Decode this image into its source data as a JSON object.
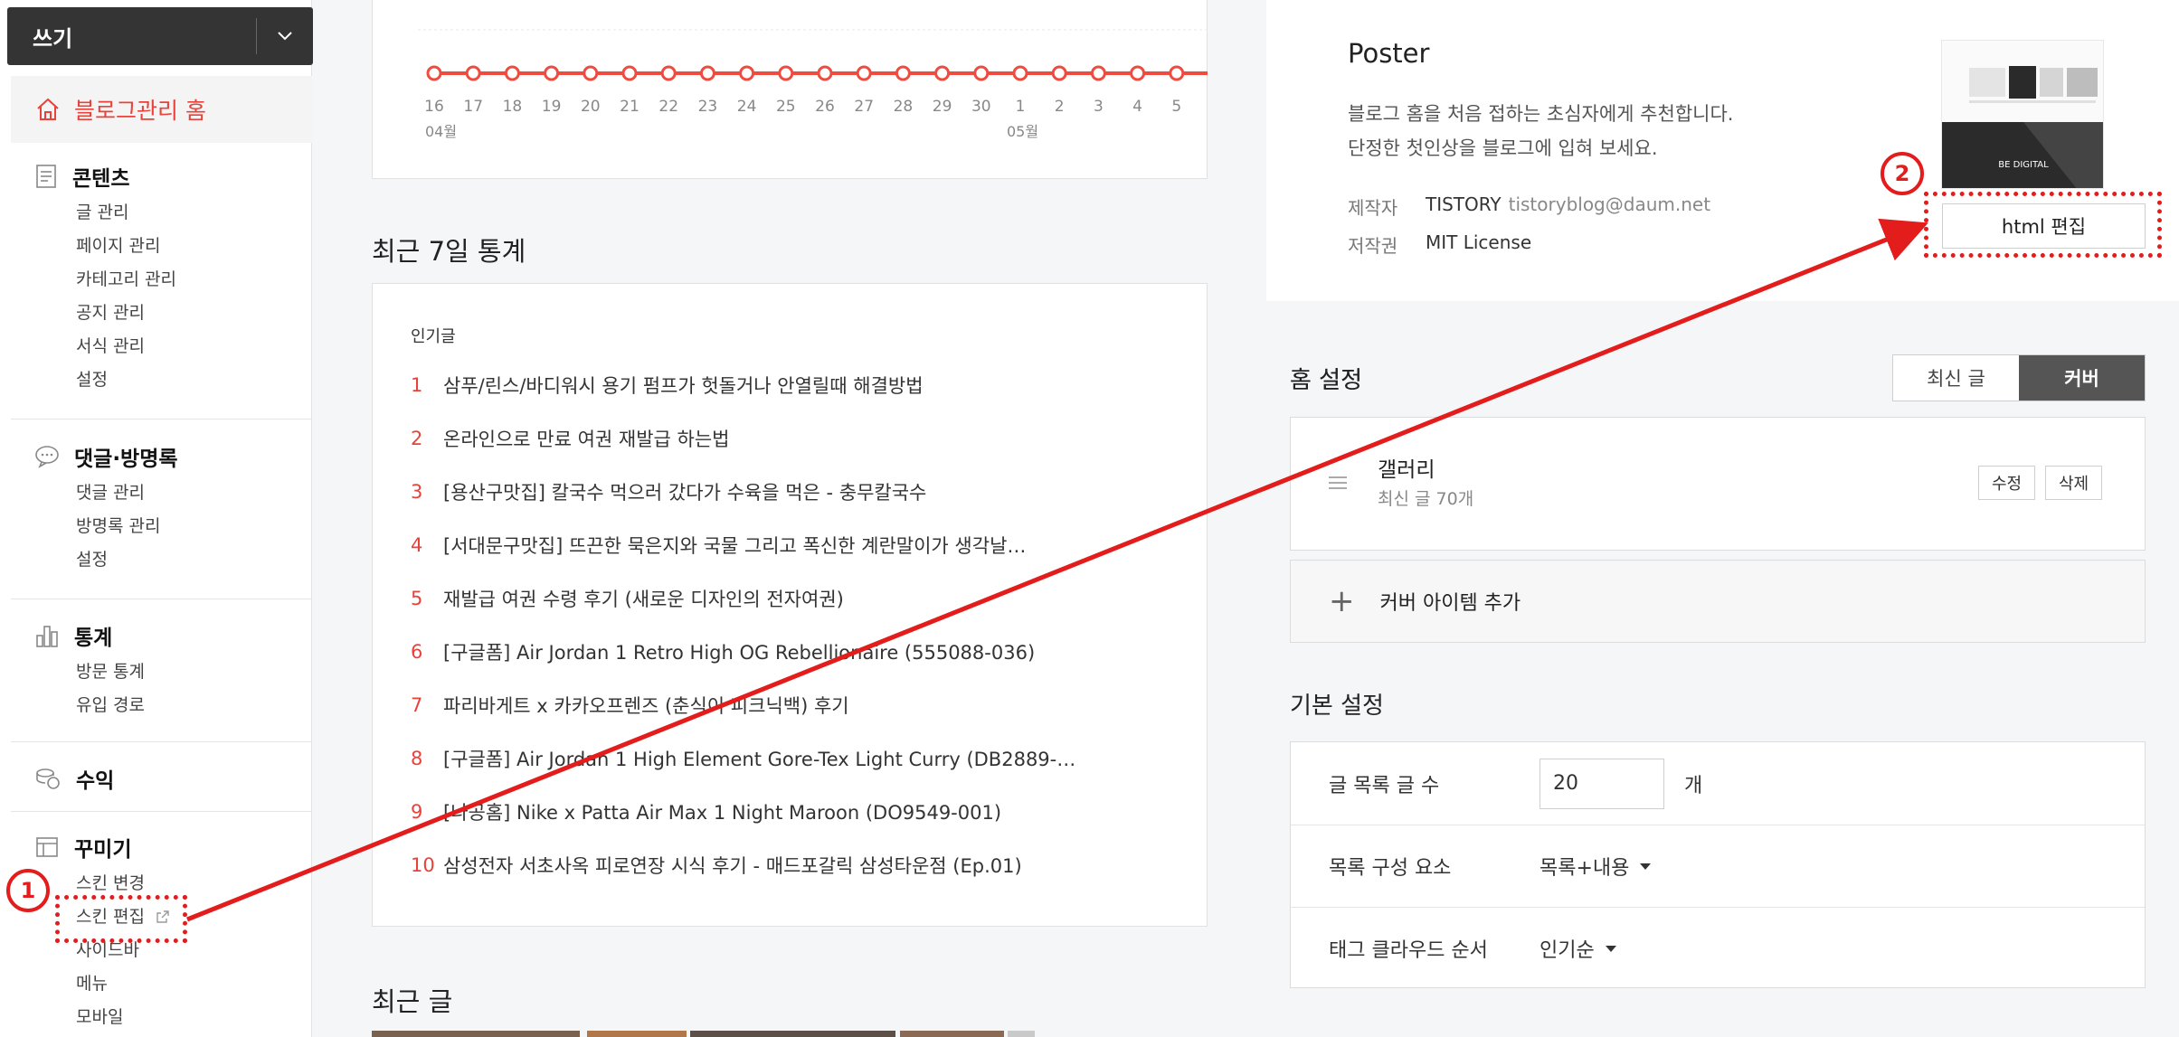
{
  "sidebar": {
    "write_label": "쓰기",
    "home_label": "블로그관리 홈",
    "sections": [
      {
        "title": "콘텐츠",
        "icon": "document-icon",
        "items": [
          "글 관리",
          "페이지 관리",
          "카테고리 관리",
          "공지 관리",
          "서식 관리",
          "설정"
        ]
      },
      {
        "title": "댓글·방명록",
        "icon": "speech-bubble-icon",
        "items": [
          "댓글 관리",
          "방명록 관리",
          "설정"
        ]
      },
      {
        "title": "통계",
        "icon": "bar-chart-icon",
        "items": [
          "방문 통계",
          "유입 경로"
        ]
      },
      {
        "title": "수익",
        "icon": "coins-icon",
        "items": []
      },
      {
        "title": "꾸미기",
        "icon": "layout-icon",
        "items": [
          "스킨 변경",
          "스킨 편집",
          "사이드바",
          "메뉴",
          "모바일"
        ]
      }
    ]
  },
  "chart": {
    "month_labels": [
      "04월",
      "05월"
    ],
    "accent": "#ef4b3f"
  },
  "chart_data": {
    "type": "line",
    "x": [
      "16",
      "17",
      "18",
      "19",
      "20",
      "21",
      "22",
      "23",
      "24",
      "25",
      "26",
      "27",
      "28",
      "29",
      "30",
      "1",
      "2",
      "3",
      "4",
      "5"
    ],
    "series": [
      {
        "values": [
          0,
          0,
          0,
          0,
          0,
          0,
          0,
          0,
          0,
          0,
          0,
          0,
          0,
          0,
          0,
          0,
          0,
          0,
          0,
          0
        ]
      }
    ],
    "grid": true
  },
  "stats": {
    "title": "최근 7일 통계",
    "popular_label": "인기글",
    "popular_posts": [
      {
        "rank": "1",
        "title": "삼푸/린스/바디워시 용기 펌프가 헛돌거나 안열릴때 해결방법"
      },
      {
        "rank": "2",
        "title": "온라인으로 만료 여권 재발급 하는법"
      },
      {
        "rank": "3",
        "title": "[용산구맛집] 칼국수 먹으러 갔다가 수육을 먹은 - 충무칼국수"
      },
      {
        "rank": "4",
        "title": "[서대문구맛집] 뜨끈한 묵은지와 국물 그리고 폭신한 계란말이가 생각날…"
      },
      {
        "rank": "5",
        "title": "재발급 여권 수령 후기 (새로운 디자인의 전자여권)"
      },
      {
        "rank": "6",
        "title": "[구글폼] Air Jordan 1 Retro High OG Rebellionaire (555088-036)"
      },
      {
        "rank": "7",
        "title": "파리바게트 x 카카오프렌즈 (춘식이 피크닉백) 후기"
      },
      {
        "rank": "8",
        "title": "[구글폼] Air Jordan 1 High Element Gore-Tex Light Curry (DB2889-…"
      },
      {
        "rank": "9",
        "title": "[나공홈] Nike x Patta Air Max 1 Night Maroon (DO9549-001)"
      },
      {
        "rank": "10",
        "title": "삼성전자 서초사옥 피로연장 시식 후기 - 매드포갈릭 삼성타운점 (Ep.01)"
      }
    ],
    "recent_title": "최근 글"
  },
  "theme": {
    "name": "Poster",
    "desc_line1": "블로그 홈을 처음 접하는 초심자에게 추천합니다.",
    "desc_line2": "단정한 첫인상을 블로그에 입혀 보세요.",
    "maker_key": "제작자",
    "maker_val": "TISTORY",
    "maker_mail": "tistoryblog@daum.net",
    "license_key": "저작권",
    "license_val": "MIT License",
    "thumb_text": "BE DIGITAL",
    "html_edit_label": "html 편집"
  },
  "home_setting": {
    "title": "홈 설정",
    "tabs": [
      {
        "label": "최신 글",
        "active": false
      },
      {
        "label": "커버",
        "active": true
      }
    ],
    "gallery_title": "갤러리",
    "gallery_sub": "최신 글 70개",
    "edit_label": "수정",
    "delete_label": "삭제",
    "add_cover_label": "커버 아이템 추가"
  },
  "basic_setting": {
    "title": "기본 설정",
    "post_count_key": "글 목록 글 수",
    "post_count_value": "20",
    "post_count_unit": "개",
    "list_elem_key": "목록 구성 요소",
    "list_elem_value": "목록+내용",
    "tag_order_key": "태그 클라우드 순서",
    "tag_order_value": "인기순"
  },
  "annotations": {
    "badge1": "1",
    "badge2": "2",
    "color": "#e31c1c"
  }
}
